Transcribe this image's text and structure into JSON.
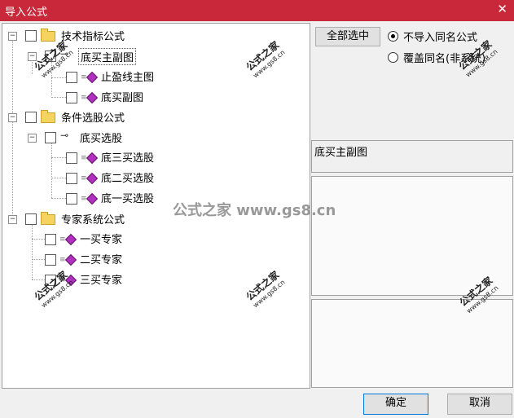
{
  "window": {
    "title": "导入公式",
    "close": "✕"
  },
  "tree": {
    "groups": [
      {
        "label": "技术指标公式"
      },
      {
        "label": "条件选股公式"
      },
      {
        "label": "专家系统公式"
      }
    ],
    "items": [
      {
        "label": "底买主副图"
      },
      {
        "label": "止盈线主图"
      },
      {
        "label": "底买副图"
      },
      {
        "label": "底买选股"
      },
      {
        "label": "底三买选股"
      },
      {
        "label": "底二买选股"
      },
      {
        "label": "底一买选股"
      },
      {
        "label": "一买专家"
      },
      {
        "label": "二买专家"
      },
      {
        "label": "三买专家"
      }
    ]
  },
  "options": {
    "select_all": "全部选中",
    "radio_skip": "不导入同名公式",
    "radio_overwrite": "覆盖同名(非系统)"
  },
  "info": {
    "selected_name": "底买主副图"
  },
  "watermark": {
    "cn": "公式之家",
    "url": "www.gs8.cn",
    "center": "公式之家 www.gs8.cn"
  },
  "footer": {
    "ok": "确定",
    "cancel": "取消"
  }
}
